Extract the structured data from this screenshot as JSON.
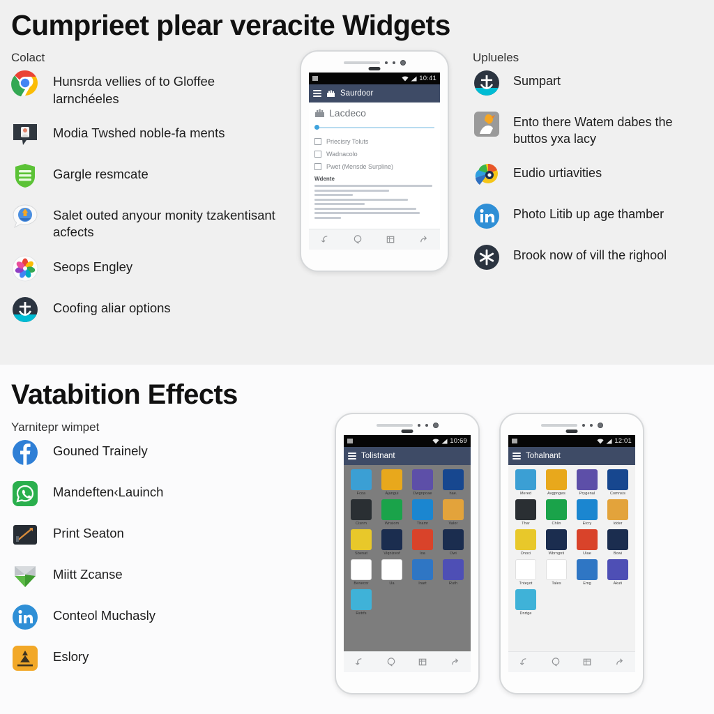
{
  "section_top": {
    "title": "Cumprieet plear veracite Widgets",
    "left_heading": "Colact",
    "right_heading": "Uplueles",
    "left_items": [
      {
        "icon": "chrome-icon",
        "label": "Hunsrda vellies of to Gloffee larnchéeles"
      },
      {
        "icon": "message-bubble-icon",
        "label": "Modia Twshed noble-fa ments"
      },
      {
        "icon": "green-shield-icon",
        "label": "Gargle resmcate"
      },
      {
        "icon": "blue-chat-icon",
        "label": "Salet outed anyour monity tzakentisant acfects"
      },
      {
        "icon": "photos-flower-icon",
        "label": "Seops Engley"
      },
      {
        "icon": "anchor-circle-icon",
        "label": "Coofing aliar options"
      }
    ],
    "right_items": [
      {
        "icon": "anchor-circle-icon",
        "label": "Sumpart"
      },
      {
        "icon": "gray-hand-icon",
        "label": "Ento there Watem dabes the buttos yxa lacy"
      },
      {
        "icon": "colorful-swirl-icon",
        "label": "Eudio urtiavities"
      },
      {
        "icon": "linkedin-icon",
        "label": "Photo Litib up age thamber"
      },
      {
        "icon": "asterisk-circle-icon",
        "label": "Brook now of vill the righool"
      }
    ],
    "phone": {
      "status_time": "10:41",
      "appbar_title": "Saurdoor",
      "content_heading": "Lacdeco",
      "checkboxes": [
        "Priecisry Toluts",
        "Wadnacolo",
        "Pwet (Mensde Surpline)"
      ],
      "section_label": "Wdente",
      "nav_icons": [
        "back-icon",
        "search-icon",
        "grid-icon",
        "share-icon"
      ]
    }
  },
  "section_bottom": {
    "title": "Vatabition Effects",
    "subhead": "Yarnitepr wimpet",
    "items": [
      {
        "icon": "facebook-icon",
        "label": "Gouned Trainely"
      },
      {
        "icon": "whatsapp-icon",
        "label": "Mandeften‹Lauinch"
      },
      {
        "icon": "dark-chart-icon",
        "label": "Print Seaton"
      },
      {
        "icon": "green-gem-icon",
        "label": "Miitt Zcanse"
      },
      {
        "icon": "linkedin-icon",
        "label": "Conteol Muchasly"
      },
      {
        "icon": "orange-app-icon",
        "label": "Eslory"
      }
    ],
    "phone_left": {
      "status_time": "10:69",
      "appbar_title": "Tolistnant",
      "theme": "dark",
      "apps": [
        {
          "label": "Fcoa",
          "color": "#3b9fd4"
        },
        {
          "label": "Ajangui",
          "color": "#e8a81c"
        },
        {
          "label": "Dwgnpoae",
          "color": "#5d4fa8"
        },
        {
          "label": "hae.",
          "color": "#17478f"
        },
        {
          "label": "Cisnm",
          "color": "#2a2f33"
        },
        {
          "label": "Wnsiom",
          "color": "#1aa34a"
        },
        {
          "label": "Thamr",
          "color": "#1b86d0"
        },
        {
          "label": "Valor",
          "color": "#e3a33b"
        },
        {
          "label": "Sbenat",
          "color": "#e8c82a"
        },
        {
          "label": "Vlqnizeof",
          "color": "#1b2d4f"
        },
        {
          "label": "Ioa",
          "color": "#d9432a"
        },
        {
          "label": "Owi",
          "color": "#1b2d4f"
        },
        {
          "label": "Benecor",
          "color": "#ffffff"
        },
        {
          "label": "Ua",
          "color": "#ffffff"
        },
        {
          "label": "Inart",
          "color": "#2f76c4"
        },
        {
          "label": "Ruth",
          "color": "#4e4fb5"
        },
        {
          "label": "Retrfs",
          "color": "#3fb2d8"
        }
      ]
    },
    "phone_right": {
      "status_time": "12:01",
      "appbar_title": "Tohalnant",
      "theme": "light",
      "apps": [
        {
          "label": "Mered",
          "color": "#3b9fd4"
        },
        {
          "label": "Avgpngws",
          "color": "#e8a81c"
        },
        {
          "label": "Prygenal",
          "color": "#5d4fa8"
        },
        {
          "label": "Comnsis",
          "color": "#17478f"
        },
        {
          "label": "Thar",
          "color": "#2a2f33"
        },
        {
          "label": "Chlin",
          "color": "#1aa34a"
        },
        {
          "label": "Eicry",
          "color": "#1b86d0"
        },
        {
          "label": "Idder",
          "color": "#e3a33b"
        },
        {
          "label": "Onoci",
          "color": "#e8c82a"
        },
        {
          "label": "Wbrngnti",
          "color": "#1b2d4f"
        },
        {
          "label": "Uiae",
          "color": "#d9432a"
        },
        {
          "label": "Bowi",
          "color": "#1b2d4f"
        },
        {
          "label": "Tnteyot",
          "color": "#ffffff"
        },
        {
          "label": "Tales",
          "color": "#ffffff"
        },
        {
          "label": "Emg",
          "color": "#2f76c4"
        },
        {
          "label": "Akuti",
          "color": "#4e4fb5"
        },
        {
          "label": "Dnrtge",
          "color": "#3fb2d8"
        }
      ]
    }
  }
}
